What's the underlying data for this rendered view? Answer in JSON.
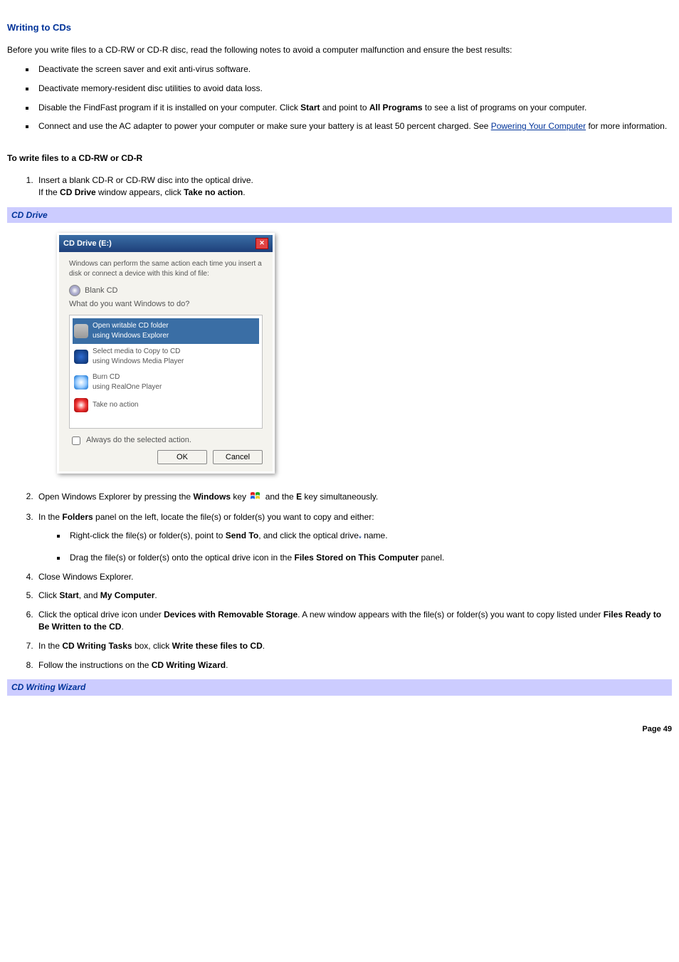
{
  "heading": "Writing to CDs",
  "intro": "Before you write files to a CD-RW or CD-R disc, read the following notes to avoid a computer malfunction and ensure the best results:",
  "bullets": {
    "b1": "Deactivate the screen saver and exit anti-virus software.",
    "b2": "Deactivate memory-resident disc utilities to avoid data loss.",
    "b3_pre": "Disable the FindFast program if it is installed on your computer. Click ",
    "b3_start": "Start",
    "b3_mid": " and point to ",
    "b3_all": "All Programs",
    "b3_post": " to see a list of programs on your computer.",
    "b4_pre": "Connect and use the AC adapter to power your computer or make sure your battery is at least 50 percent charged. See ",
    "b4_link": "Powering Your Computer",
    "b4_post": " for more information."
  },
  "subheading": "To write files to a CD-RW or CD-R",
  "step1_a": "Insert a blank CD-R or CD-RW disc into the optical drive.",
  "step1_b_pre": "If the ",
  "step1_b_cd": "CD Drive",
  "step1_b_mid": " window appears, click ",
  "step1_b_act": "Take no action",
  "step1_b_post": ".",
  "caption1": "CD Drive",
  "dialog": {
    "title": "CD Drive (E:)",
    "intro": "Windows can perform the same action each time you insert a disk or connect a device with this kind of file:",
    "blank": "Blank CD",
    "prompt": "What do you want Windows to do?",
    "items": [
      {
        "l1": "Open writable CD folder",
        "l2": "using Windows Explorer"
      },
      {
        "l1": "Select media to Copy to CD",
        "l2": "using Windows Media Player"
      },
      {
        "l1": "Burn CD",
        "l2": "using RealOne Player"
      },
      {
        "l1": "Take no action",
        "l2": ""
      }
    ],
    "checkbox": "Always do the selected action.",
    "ok": "OK",
    "cancel": "Cancel"
  },
  "step2_pre": "Open Windows Explorer by pressing the ",
  "step2_win": "Windows",
  "step2_mid": " key ",
  "step2_mid2": " and the ",
  "step2_e": "E",
  "step2_post": " key simultaneously.",
  "step3_pre": "In the ",
  "step3_folders": "Folders",
  "step3_post": " panel on the left, locate the file(s) or folder(s) you want to copy and either:",
  "step3a_pre": "Right-click the file(s) or folder(s), point to ",
  "step3a_sendto": "Send To",
  "step3a_mid": ", and click the optical drive",
  "step3a_sup": "*",
  "step3a_post": " name.",
  "step3b_pre": "Drag the file(s) or folder(s) onto the optical drive icon in the ",
  "step3b_panel": "Files Stored on This Computer",
  "step3b_post": " panel.",
  "step4": "Close Windows Explorer.",
  "step5_pre": "Click ",
  "step5_start": "Start",
  "step5_mid": ", and ",
  "step5_myc": "My Computer",
  "step5_post": ".",
  "step6_pre": "Click the optical drive icon under ",
  "step6_dev": "Devices with Removable Storage",
  "step6_mid": ". A new window appears with the file(s) or folder(s) you want to copy listed under ",
  "step6_ready": "Files Ready to Be Written to the CD",
  "step6_post": ".",
  "step7_pre": "In the ",
  "step7_box": "CD Writing Tasks",
  "step7_mid": " box, click ",
  "step7_action": "Write these files to CD",
  "step7_post": ".",
  "step8_pre": "Follow the instructions on the ",
  "step8_wizard": "CD Writing Wizard",
  "step8_post": ".",
  "caption2": "CD Writing Wizard",
  "page": "Page 49"
}
